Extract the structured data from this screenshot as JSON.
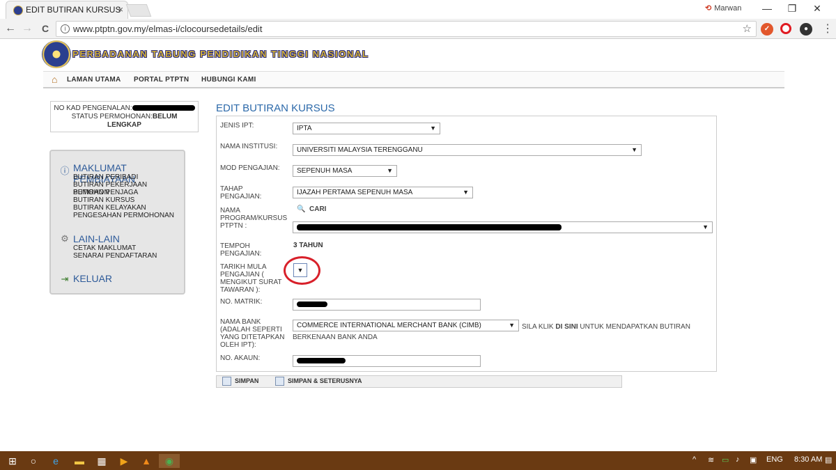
{
  "browser": {
    "tab_title": "EDIT BUTIRAN KURSUS",
    "tab_close": "×",
    "user_name": "Marwan",
    "url": "www.ptptn.gov.my/elmas-i/clocoursedetails/edit",
    "back": "←",
    "forward": "→",
    "reload": "C",
    "star": "☆",
    "menu": "⋮",
    "minimize": "—",
    "restore": "❐",
    "close": "✕"
  },
  "header": {
    "org_name": "PERBADANAN TABUNG PENDIDIKAN TINGGI NASIONAL"
  },
  "nav": {
    "home": "LAMAN UTAMA",
    "portal": "PORTAL PTPTN",
    "contact": "HUBUNGI KAMI"
  },
  "userbox": {
    "id_label": "NO KAD PENGENALAN:",
    "status_label": "STATUS PERMOHONAN:",
    "status_value_1": "BELUM",
    "status_value_2": "LENGKAP"
  },
  "sidebar": {
    "section1_title": "MAKLUMAT PEMBIAYAAN",
    "section1_items": [
      "BUTIRAN PERIBADI",
      "BUTIRAN PEKERJAAN PEMOHON",
      "BUTIRAN PENJAGA",
      "BUTIRAN KURSUS",
      "BUTIRAN KELAYAKAN",
      "PENGESAHAN PERMOHONAN"
    ],
    "section2_title": "LAIN-LAIN",
    "section2_items": [
      "CETAK MAKLUMAT",
      "SENARAI PENDAFTARAN"
    ],
    "section3_title": "KELUAR"
  },
  "form": {
    "title": "EDIT BUTIRAN KURSUS",
    "jenis_ipt_label": "JENIS IPT:",
    "jenis_ipt_value": "IPTA",
    "institusi_label": "NAMA INSTITUSI:",
    "institusi_value": "UNIVERSITI MALAYSIA TERENGGANU",
    "mod_label": "MOD PENGAJIAN:",
    "mod_value": "SEPENUH MASA",
    "tahap_label_1": "TAHAP",
    "tahap_label_2": "PENGAJIAN:",
    "tahap_value": "IJAZAH PERTAMA SEPENUH MASA",
    "program_label_1": "NAMA",
    "program_label_2": "PROGRAM/KURSUS",
    "program_label_3": "PTPTN :",
    "cari": "CARI",
    "tempoh_label_1": "TEMPOH",
    "tempoh_label_2": "PENGAJIAN:",
    "tempoh_value": "3 TAHUN",
    "tarikh_label_1": "TARIKH MULA",
    "tarikh_label_2": "PENGAJIAN (",
    "tarikh_label_3": "MENGIKUT SURAT",
    "tarikh_label_4": "TAWARAN ):",
    "matrik_label": "NO. MATRIK:",
    "bank_label_1": "NAMA BANK",
    "bank_label_2": "(ADALAH SEPERTI",
    "bank_label_3": "YANG DITETAPKAN",
    "bank_label_4": "OLEH IPT):",
    "bank_value": "COMMERCE INTERNATIONAL MERCHANT BANK (CIMB)",
    "bank_note_1": "SILA KLIK",
    "bank_note_link": "DI SINI",
    "bank_note_2": "UNTUK MENDAPATKAN BUTIRAN",
    "bank_note_3": "BERKENAAN BANK ANDA",
    "akaun_label": "NO. AKAUN:",
    "arrow": "▼"
  },
  "buttons": {
    "save": "SIMPAN",
    "save_next": "SIMPAN & SETERUSNYA"
  },
  "taskbar": {
    "lang": "ENG",
    "time": "8:30 AM"
  }
}
